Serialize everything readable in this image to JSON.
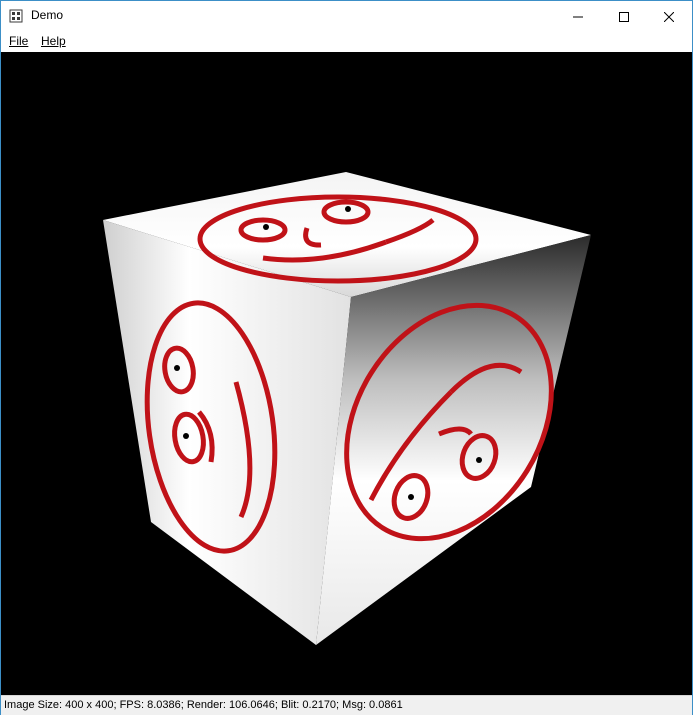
{
  "window": {
    "title": "Demo",
    "icons": {
      "app": "app-icon",
      "minimize": "minimize-icon",
      "maximize": "maximize-icon",
      "close": "close-icon"
    }
  },
  "menu": {
    "items": [
      {
        "label": "File"
      },
      {
        "label": "Help"
      }
    ]
  },
  "viewport": {
    "background": "#000000",
    "scene": "textured-cube",
    "cube_face_color": "#ffffff",
    "texture_color": "#c01218"
  },
  "status": {
    "text": "Image Size: 400 x 400; FPS: 8.0386; Render: 106.0646; Blit: 0.2170; Msg: 0.0861"
  }
}
